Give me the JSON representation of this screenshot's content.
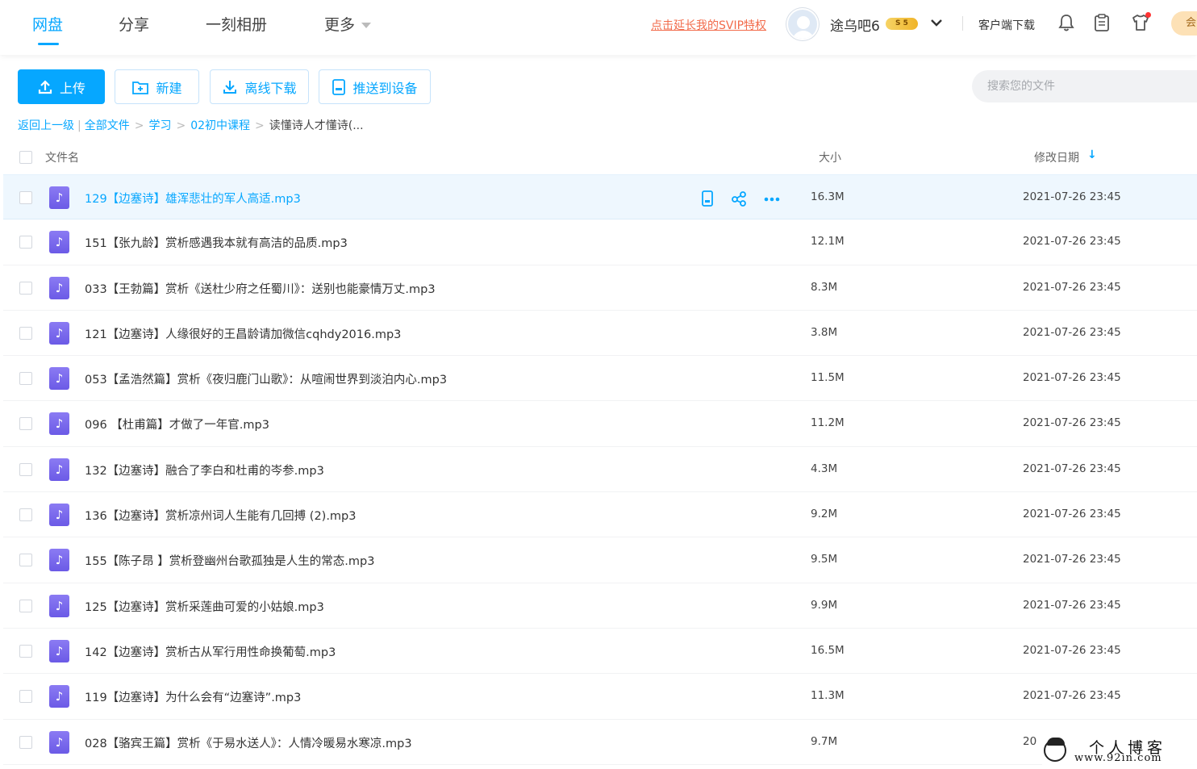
{
  "nav": {
    "items": [
      {
        "label": "网盘",
        "active": true
      },
      {
        "label": "分享",
        "active": false
      },
      {
        "label": "一刻相册",
        "active": false
      },
      {
        "label": "更多",
        "active": false
      }
    ]
  },
  "header": {
    "svip_link": "点击延长我的SVIP特权",
    "username": "途乌吧6",
    "vip_badge": "S 5",
    "client_download": "客户端下载",
    "right_btn": "会"
  },
  "toolbar": {
    "upload": "上传",
    "new": "新建",
    "offline_download": "离线下载",
    "push_device": "推送到设备",
    "search_placeholder": "搜索您的文件"
  },
  "breadcrumb": {
    "back": "返回上一级",
    "all_files": "全部文件",
    "level1": "学习",
    "level2": "02初中课程",
    "current": "读懂诗人才懂诗(..."
  },
  "table": {
    "col_name": "文件名",
    "col_size": "大小",
    "col_date": "修改日期",
    "rows": [
      {
        "name": "129【边塞诗】雄浑悲壮的军人高适.mp3",
        "size": "16.3M",
        "date": "2021-07-26 23:45"
      },
      {
        "name": "151【张九龄】赏析感遇我本就有高洁的品质.mp3",
        "size": "12.1M",
        "date": "2021-07-26 23:45"
      },
      {
        "name": "033【王勃篇】赏析《送杜少府之任蜀川》：送别也能豪情万丈.mp3",
        "size": "8.3M",
        "date": "2021-07-26 23:45"
      },
      {
        "name": "121【边塞诗】人缘很好的王昌龄请加微信cqhdy2016.mp3",
        "size": "3.8M",
        "date": "2021-07-26 23:45"
      },
      {
        "name": "053【孟浩然篇】赏析《夜归鹿门山歌》：从喧闹世界到淡泊内心.mp3",
        "size": "11.5M",
        "date": "2021-07-26 23:45"
      },
      {
        "name": "096 【杜甫篇】才做了一年官.mp3",
        "size": "11.2M",
        "date": "2021-07-26 23:45"
      },
      {
        "name": "132【边塞诗】融合了李白和杜甫的岑参.mp3",
        "size": "4.3M",
        "date": "2021-07-26 23:45"
      },
      {
        "name": "136【边塞诗】赏析凉州词人生能有几回搏 (2).mp3",
        "size": "9.2M",
        "date": "2021-07-26 23:45"
      },
      {
        "name": "155【陈子昂 】赏析登幽州台歌孤独是人生的常态.mp3",
        "size": "9.5M",
        "date": "2021-07-26 23:45"
      },
      {
        "name": "125【边塞诗】赏析采莲曲可爱的小姑娘.mp3",
        "size": "9.9M",
        "date": "2021-07-26 23:45"
      },
      {
        "name": "142【边塞诗】赏析古从军行用性命换葡萄.mp3",
        "size": "16.5M",
        "date": "2021-07-26 23:45"
      },
      {
        "name": "119【边塞诗】为什么会有“边塞诗”.mp3",
        "size": "11.3M",
        "date": "2021-07-26 23:45"
      },
      {
        "name": "028【骆宾王篇】赏析《于易水送人》：人情冷暖易水寒凉.mp3",
        "size": "9.7M",
        "date": "20"
      }
    ]
  },
  "watermark": {
    "title": "个人博客",
    "url": "www.92in.com"
  },
  "colors": {
    "accent": "#06a7ff",
    "svip": "#f26b4b",
    "audio_icon": "#7465ee"
  }
}
